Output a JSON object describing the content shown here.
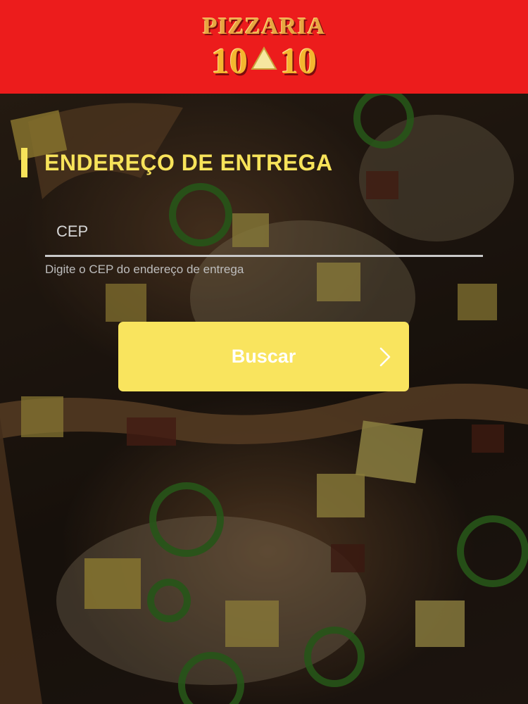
{
  "header": {
    "logo_word": "PIZZARIA",
    "logo_left": "10",
    "logo_right": "10",
    "background": "#ec1c1c"
  },
  "form": {
    "title": "ENDEREÇO DE ENTREGA",
    "cep_placeholder": "CEP",
    "cep_value": "",
    "cep_help": "Digite o CEP do endereço de entrega",
    "search_label": "Buscar",
    "search_icon": "chevron-right-icon"
  },
  "colors": {
    "accent": "#f7e35a",
    "button": "#f9e45e"
  }
}
